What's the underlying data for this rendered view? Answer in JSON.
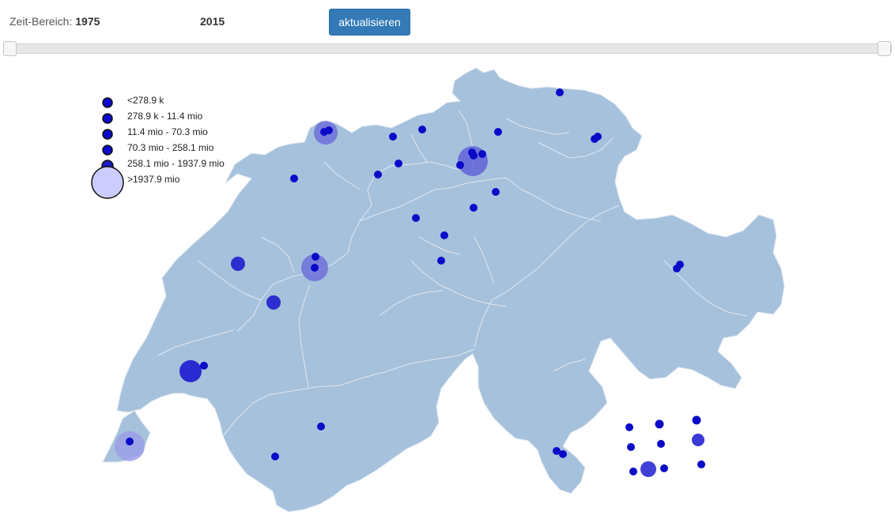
{
  "controls": {
    "range_prefix": "Zeit-Bereich:",
    "range_start": "1975",
    "range_end": "2015",
    "update_button": "aktualisieren"
  },
  "legend": {
    "items": [
      {
        "label": "<278.9 k"
      },
      {
        "label": "278.9 k - 11.4 mio"
      },
      {
        "label": "11.4 mio - 70.3 mio"
      },
      {
        "label": "70.3 mio - 258.1 mio"
      },
      {
        "label": "258.1 mio - 1937.9 mio"
      },
      {
        "label": ">1937.9 mio"
      }
    ]
  },
  "colors": {
    "map_fill": "#a6c1dc",
    "map_borders": "#dfe8f1",
    "marker_small": "#0a0ac8",
    "marker_medium": "#2d2dd0",
    "marker_large_fill": "#5b5bd6",
    "marker_xl_fill": "#8c8ce0",
    "legend_xl_fill": "#ccccff",
    "button_bg": "#337ab7"
  }
}
